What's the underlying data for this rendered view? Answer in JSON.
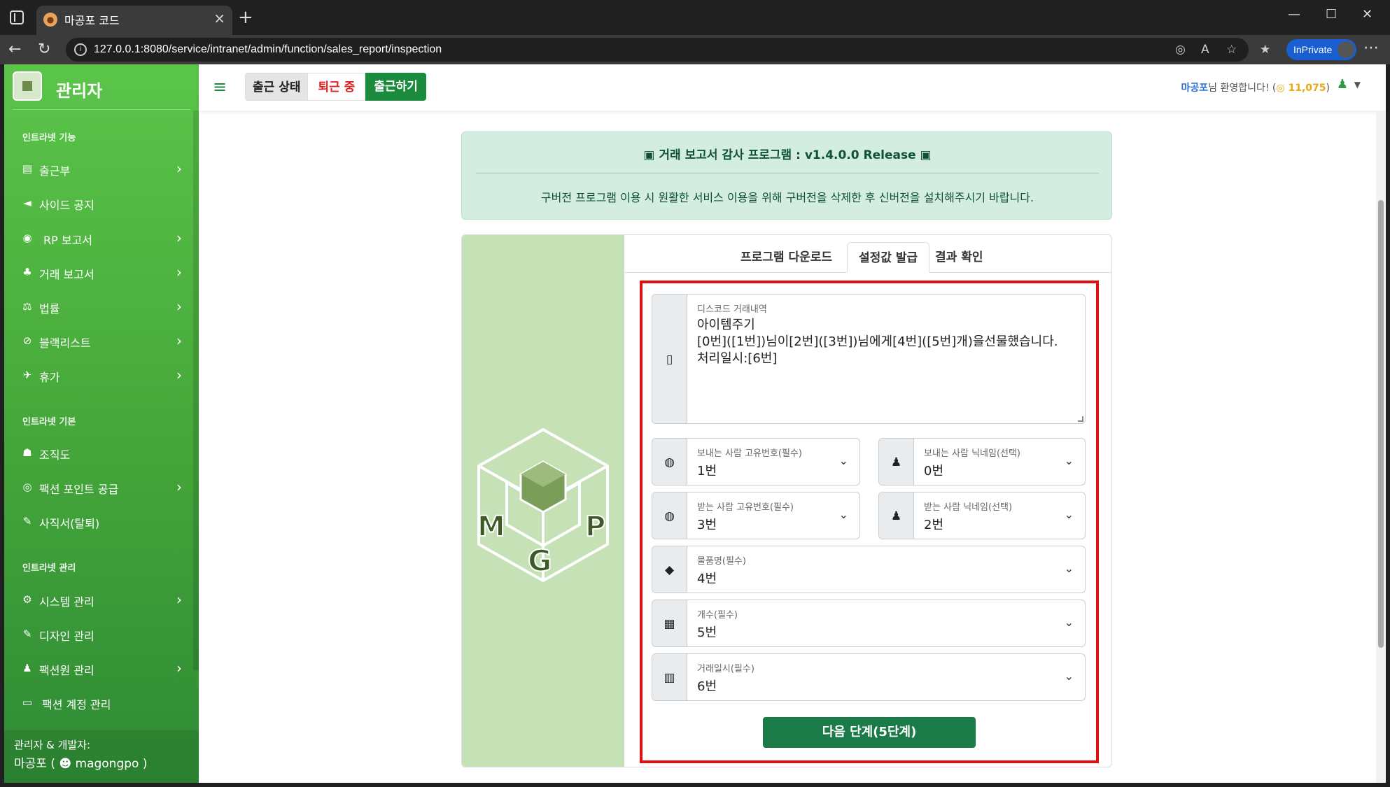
{
  "browser": {
    "tab_title": "마공포 코드",
    "url": "127.0.0.1:8080/service/intranet/admin/function/sales_report/inspection",
    "inprivate_label": "InPrivate"
  },
  "sidebar": {
    "brand": "관리자",
    "sections": [
      {
        "heading": "인트라넷 기능",
        "items": [
          {
            "label": "출근부",
            "icon": "book-icon",
            "chevron": true
          },
          {
            "label": "사이드 공지",
            "icon": "megaphone-icon",
            "chevron": false
          },
          {
            "label": "RP 보고서",
            "icon": "gamepad-icon",
            "chevron": true
          },
          {
            "label": "거래 보고서",
            "icon": "money-bag-icon",
            "chevron": true
          },
          {
            "label": "법률",
            "icon": "scale-icon",
            "chevron": true
          },
          {
            "label": "블랙리스트",
            "icon": "ban-icon",
            "chevron": true
          },
          {
            "label": "휴가",
            "icon": "plane-icon",
            "chevron": true
          }
        ]
      },
      {
        "heading": "인트라넷 기본",
        "items": [
          {
            "label": "조직도",
            "icon": "sitemap-icon",
            "chevron": false
          },
          {
            "label": "팩션 포인트 공급",
            "icon": "coins-icon",
            "chevron": true
          },
          {
            "label": "사직서(탈퇴)",
            "icon": "pen-icon",
            "chevron": false
          }
        ]
      },
      {
        "heading": "인트라넷 관리",
        "items": [
          {
            "label": "시스템 관리",
            "icon": "gear-icon",
            "chevron": true
          },
          {
            "label": "디자인 관리",
            "icon": "brush-icon",
            "chevron": false
          },
          {
            "label": "팩션원 관리",
            "icon": "user-gear-icon",
            "chevron": true
          },
          {
            "label": "팩션 계정 관리",
            "icon": "id-card-icon",
            "chevron": false
          }
        ]
      }
    ],
    "footer_line1": "관리자 & 개발자:",
    "footer_line2_prefix": "마공포 (",
    "footer_line2_name": "magongpo",
    "footer_line2_suffix": ")"
  },
  "topbar": {
    "status_label": "출근 상태",
    "status_value": "퇴근 중",
    "clock_in_button": "출근하기",
    "welcome_name": "마공포",
    "welcome_text": "님 환영합니다! (",
    "points": "11,075",
    "welcome_close": ")"
  },
  "alert": {
    "title": "거래 보고서 감사 프로그램 : v1.4.0.0 Release",
    "message": "구버전 프로그램 이용 시 원활한 서비스 이용을 위해 구버전을 삭제한 후 신버전을 설치해주시기 바랍니다."
  },
  "tabs": [
    {
      "label": "프로그램 다운로드",
      "active": false
    },
    {
      "label": "설정값 발급",
      "active": true
    },
    {
      "label": "결과 확인",
      "active": false
    }
  ],
  "logo_letters": {
    "m": "M",
    "g": "G",
    "p": "P"
  },
  "form": {
    "discord": {
      "label": "디스코드 거래내역",
      "value": "아이템주기\n[0번]([1번])님이[2번]([3번])님에게[4번]([5번]개)을선물했습니다.\n처리일시:[6번]"
    },
    "sender_id": {
      "label": "보내는 사람 고유번호(필수)",
      "value": "1번"
    },
    "sender_nick": {
      "label": "보내는 사람 닉네임(선택)",
      "value": "0번"
    },
    "receiver_id": {
      "label": "받는 사람 고유번호(필수)",
      "value": "3번"
    },
    "receiver_nick": {
      "label": "받는 사람 닉네임(선택)",
      "value": "2번"
    },
    "item_name": {
      "label": "물품명(필수)",
      "value": "4번"
    },
    "count": {
      "label": "개수(필수)",
      "value": "5번"
    },
    "trade_time": {
      "label": "거래일시(필수)",
      "value": "6번"
    },
    "next_button": "다음 단계(5단계)"
  }
}
